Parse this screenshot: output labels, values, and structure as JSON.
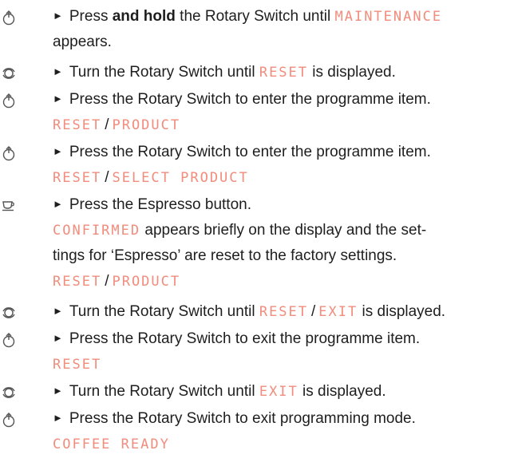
{
  "bullet": "►",
  "steps": [
    {
      "icon": "press-icon",
      "pre": "Press ",
      "bold": "and hold",
      "mid": " the Rotary Switch until ",
      "display": "MAINTENANCE",
      "line2": "appears."
    },
    {
      "icon": "rotate-icon",
      "pre": "Turn the Rotary Switch until ",
      "display": "RESET",
      "post": " is displayed."
    },
    {
      "icon": "press-icon",
      "text": "Press the Rotary Switch to enter the programme item.",
      "display_a": "RESET",
      "sep": "/",
      "display_b": "PRODUCT"
    },
    {
      "icon": "press-icon",
      "text": "Press the Rotary Switch to enter the programme item.",
      "display_a": "RESET",
      "sep": "/",
      "display_b": "SELECT PRODUCT"
    },
    {
      "icon": "cup-icon",
      "text": "Press the Espresso button.",
      "display_c": "CONFIRMED",
      "line2_post": " appears briefly on the display and the set-",
      "line3": "tings for ‘Espresso’ are reset to the factory settings.",
      "display_a": "RESET",
      "sep": "/",
      "display_b": "PRODUCT"
    },
    {
      "icon": "rotate-icon",
      "pre": "Turn the Rotary Switch until ",
      "display_a": "RESET",
      "sep": "/",
      "display_b": "EXIT",
      "post": " is displayed."
    },
    {
      "icon": "press-icon",
      "text": "Press the Rotary Switch to exit the programme item.",
      "display": "RESET"
    },
    {
      "icon": "rotate-icon",
      "pre": "Turn the Rotary Switch until ",
      "display": "EXIT",
      "post": " is displayed."
    },
    {
      "icon": "press-icon",
      "text": "Press the Rotary Switch to exit programming mode.",
      "display": "COFFEE READY"
    }
  ]
}
